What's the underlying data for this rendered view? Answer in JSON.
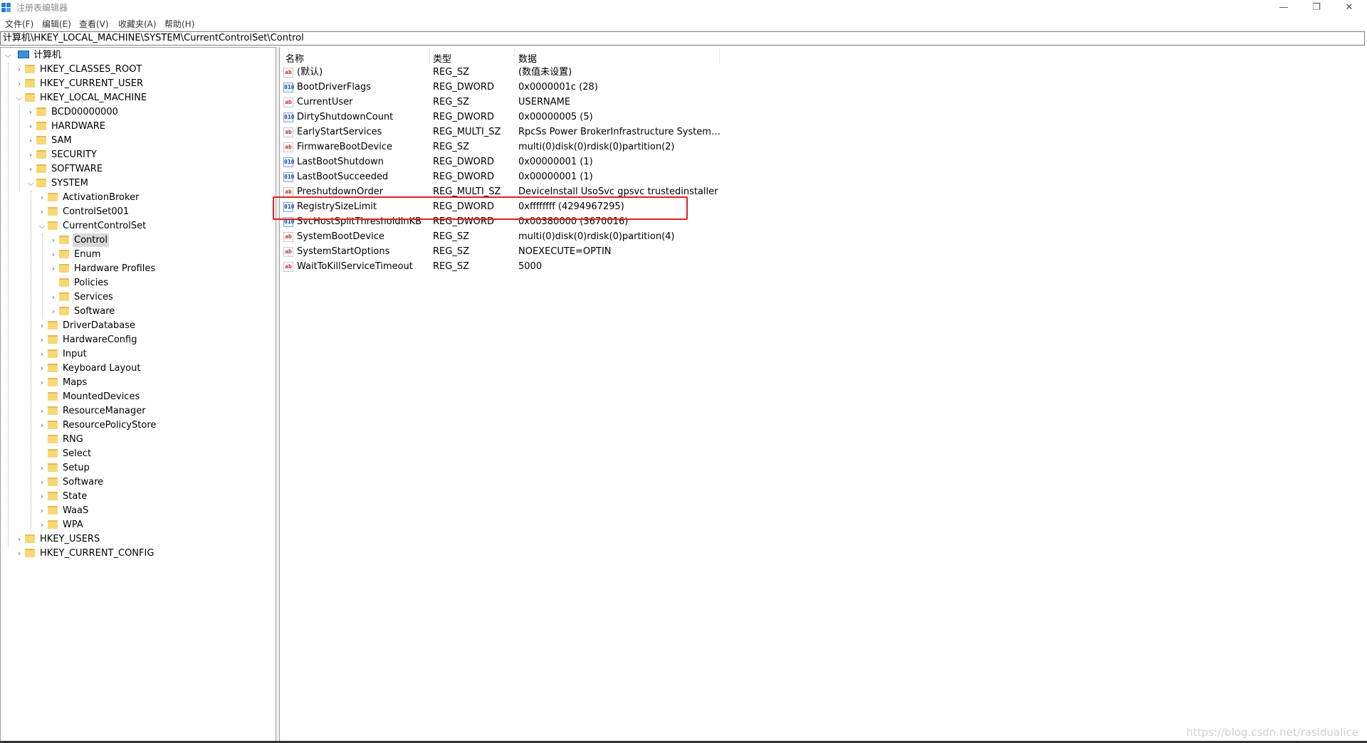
{
  "window": {
    "title": "注册表编辑器",
    "minimize_glyph": "—",
    "restore_glyph": "❐",
    "close_glyph": "✕"
  },
  "menu": [
    "文件(F)",
    "编辑(E)",
    "查看(V)",
    "收藏夹(A)",
    "帮助(H)"
  ],
  "address": "计算机\\HKEY_LOCAL_MACHINE\\SYSTEM\\CurrentControlSet\\Control",
  "tree": [
    {
      "label": "计算机",
      "level": 0,
      "expanded": true,
      "icon": "computer-icon"
    },
    {
      "label": "HKEY_CLASSES_ROOT",
      "level": 1,
      "expandable": true
    },
    {
      "label": "HKEY_CURRENT_USER",
      "level": 1,
      "expandable": true
    },
    {
      "label": "HKEY_LOCAL_MACHINE",
      "level": 1,
      "expanded": true
    },
    {
      "label": "BCD00000000",
      "level": 2,
      "expandable": true
    },
    {
      "label": "HARDWARE",
      "level": 2,
      "expandable": true
    },
    {
      "label": "SAM",
      "level": 2,
      "expandable": true
    },
    {
      "label": "SECURITY",
      "level": 2,
      "expandable": true
    },
    {
      "label": "SOFTWARE",
      "level": 2,
      "expandable": true
    },
    {
      "label": "SYSTEM",
      "level": 2,
      "expanded": true
    },
    {
      "label": "ActivationBroker",
      "level": 3,
      "expandable": true
    },
    {
      "label": "ControlSet001",
      "level": 3,
      "expandable": true
    },
    {
      "label": "CurrentControlSet",
      "level": 3,
      "expanded": true
    },
    {
      "label": "Control",
      "level": 4,
      "expandable": true,
      "selected": true
    },
    {
      "label": "Enum",
      "level": 4,
      "expandable": true
    },
    {
      "label": "Hardware Profiles",
      "level": 4,
      "expandable": true
    },
    {
      "label": "Policies",
      "level": 4,
      "expandable": false
    },
    {
      "label": "Services",
      "level": 4,
      "expandable": true
    },
    {
      "label": "Software",
      "level": 4,
      "expandable": true
    },
    {
      "label": "DriverDatabase",
      "level": 3,
      "expandable": true
    },
    {
      "label": "HardwareConfig",
      "level": 3,
      "expandable": true
    },
    {
      "label": "Input",
      "level": 3,
      "expandable": true
    },
    {
      "label": "Keyboard Layout",
      "level": 3,
      "expandable": true
    },
    {
      "label": "Maps",
      "level": 3,
      "expandable": true
    },
    {
      "label": "MountedDevices",
      "level": 3,
      "expandable": false
    },
    {
      "label": "ResourceManager",
      "level": 3,
      "expandable": true
    },
    {
      "label": "ResourcePolicyStore",
      "level": 3,
      "expandable": true
    },
    {
      "label": "RNG",
      "level": 3,
      "expandable": false
    },
    {
      "label": "Select",
      "level": 3,
      "expandable": false
    },
    {
      "label": "Setup",
      "level": 3,
      "expandable": true
    },
    {
      "label": "Software",
      "level": 3,
      "expandable": true
    },
    {
      "label": "State",
      "level": 3,
      "expandable": true
    },
    {
      "label": "WaaS",
      "level": 3,
      "expandable": true
    },
    {
      "label": "WPA",
      "level": 3,
      "expandable": true
    },
    {
      "label": "HKEY_USERS",
      "level": 1,
      "expandable": true
    },
    {
      "label": "HKEY_CURRENT_CONFIG",
      "level": 1,
      "expandable": true
    }
  ],
  "columns": {
    "name": "名称",
    "type": "类型",
    "data": "数据"
  },
  "values": [
    {
      "icon": "sz",
      "glyph": "ab",
      "name": "(默认)",
      "type": "REG_SZ",
      "data": "(数值未设置)"
    },
    {
      "icon": "dw",
      "glyph": "010",
      "name": "BootDriverFlags",
      "type": "REG_DWORD",
      "data": "0x0000001c (28)"
    },
    {
      "icon": "sz",
      "glyph": "ab",
      "name": "CurrentUser",
      "type": "REG_SZ",
      "data": "USERNAME"
    },
    {
      "icon": "dw",
      "glyph": "010",
      "name": "DirtyShutdownCount",
      "type": "REG_DWORD",
      "data": "0x00000005 (5)"
    },
    {
      "icon": "sz",
      "glyph": "ab",
      "name": "EarlyStartServices",
      "type": "REG_MULTI_SZ",
      "data": "RpcSs Power BrokerInfrastructure SystemEve..."
    },
    {
      "icon": "sz",
      "glyph": "ab",
      "name": "FirmwareBootDevice",
      "type": "REG_SZ",
      "data": "multi(0)disk(0)rdisk(0)partition(2)"
    },
    {
      "icon": "dw",
      "glyph": "010",
      "name": "LastBootShutdown",
      "type": "REG_DWORD",
      "data": "0x00000001 (1)"
    },
    {
      "icon": "dw",
      "glyph": "010",
      "name": "LastBootSucceeded",
      "type": "REG_DWORD",
      "data": "0x00000001 (1)"
    },
    {
      "icon": "sz",
      "glyph": "ab",
      "name": "PreshutdownOrder",
      "type": "REG_MULTI_SZ",
      "data": "DeviceInstall UsoSvc gpsvc trustedinstaller"
    },
    {
      "icon": "dw",
      "glyph": "010",
      "name": "RegistrySizeLimit",
      "type": "REG_DWORD",
      "data": "0xffffffff (4294967295)"
    },
    {
      "icon": "dw",
      "glyph": "010",
      "name": "SvcHostSplitThresholdInKB",
      "type": "REG_DWORD",
      "data": "0x00380000 (3670016)"
    },
    {
      "icon": "sz",
      "glyph": "ab",
      "name": "SystemBootDevice",
      "type": "REG_SZ",
      "data": "multi(0)disk(0)rdisk(0)partition(4)"
    },
    {
      "icon": "sz",
      "glyph": "ab",
      "name": "SystemStartOptions",
      "type": "REG_SZ",
      "data": " NOEXECUTE=OPTIN"
    },
    {
      "icon": "sz",
      "glyph": "ab",
      "name": "WaitToKillServiceTimeout",
      "type": "REG_SZ",
      "data": "5000"
    }
  ],
  "highlighted_value": "RegistrySizeLimit",
  "watermark": "https://blog.csdn.net/rasidualice",
  "colors": {
    "highlight_border": "#e02020",
    "selected_bg": "#d9d9d9",
    "folder": "#f8d775"
  }
}
